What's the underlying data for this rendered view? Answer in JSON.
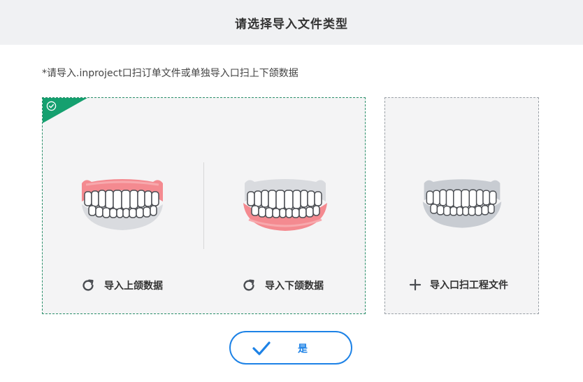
{
  "dialog": {
    "title": "请选择导入文件类型",
    "notice": "*请导入.inproject口扫订单文件或单独导入口扫上下颌数据"
  },
  "left_card": {
    "selected": true,
    "upper": {
      "label": "导入上颌数据",
      "icon": "refresh-icon"
    },
    "lower": {
      "label": "导入下颌数据",
      "icon": "refresh-icon"
    }
  },
  "right_card": {
    "label": "导入口扫工程文件",
    "icon": "plus-icon"
  },
  "confirm": {
    "label": "是",
    "icon": "check-icon"
  },
  "colors": {
    "selected_accent": "#15a06f",
    "primary_blue": "#1d82e6",
    "highlight_pink": "#f47f86",
    "gum_gray": "#c8ccd2"
  }
}
